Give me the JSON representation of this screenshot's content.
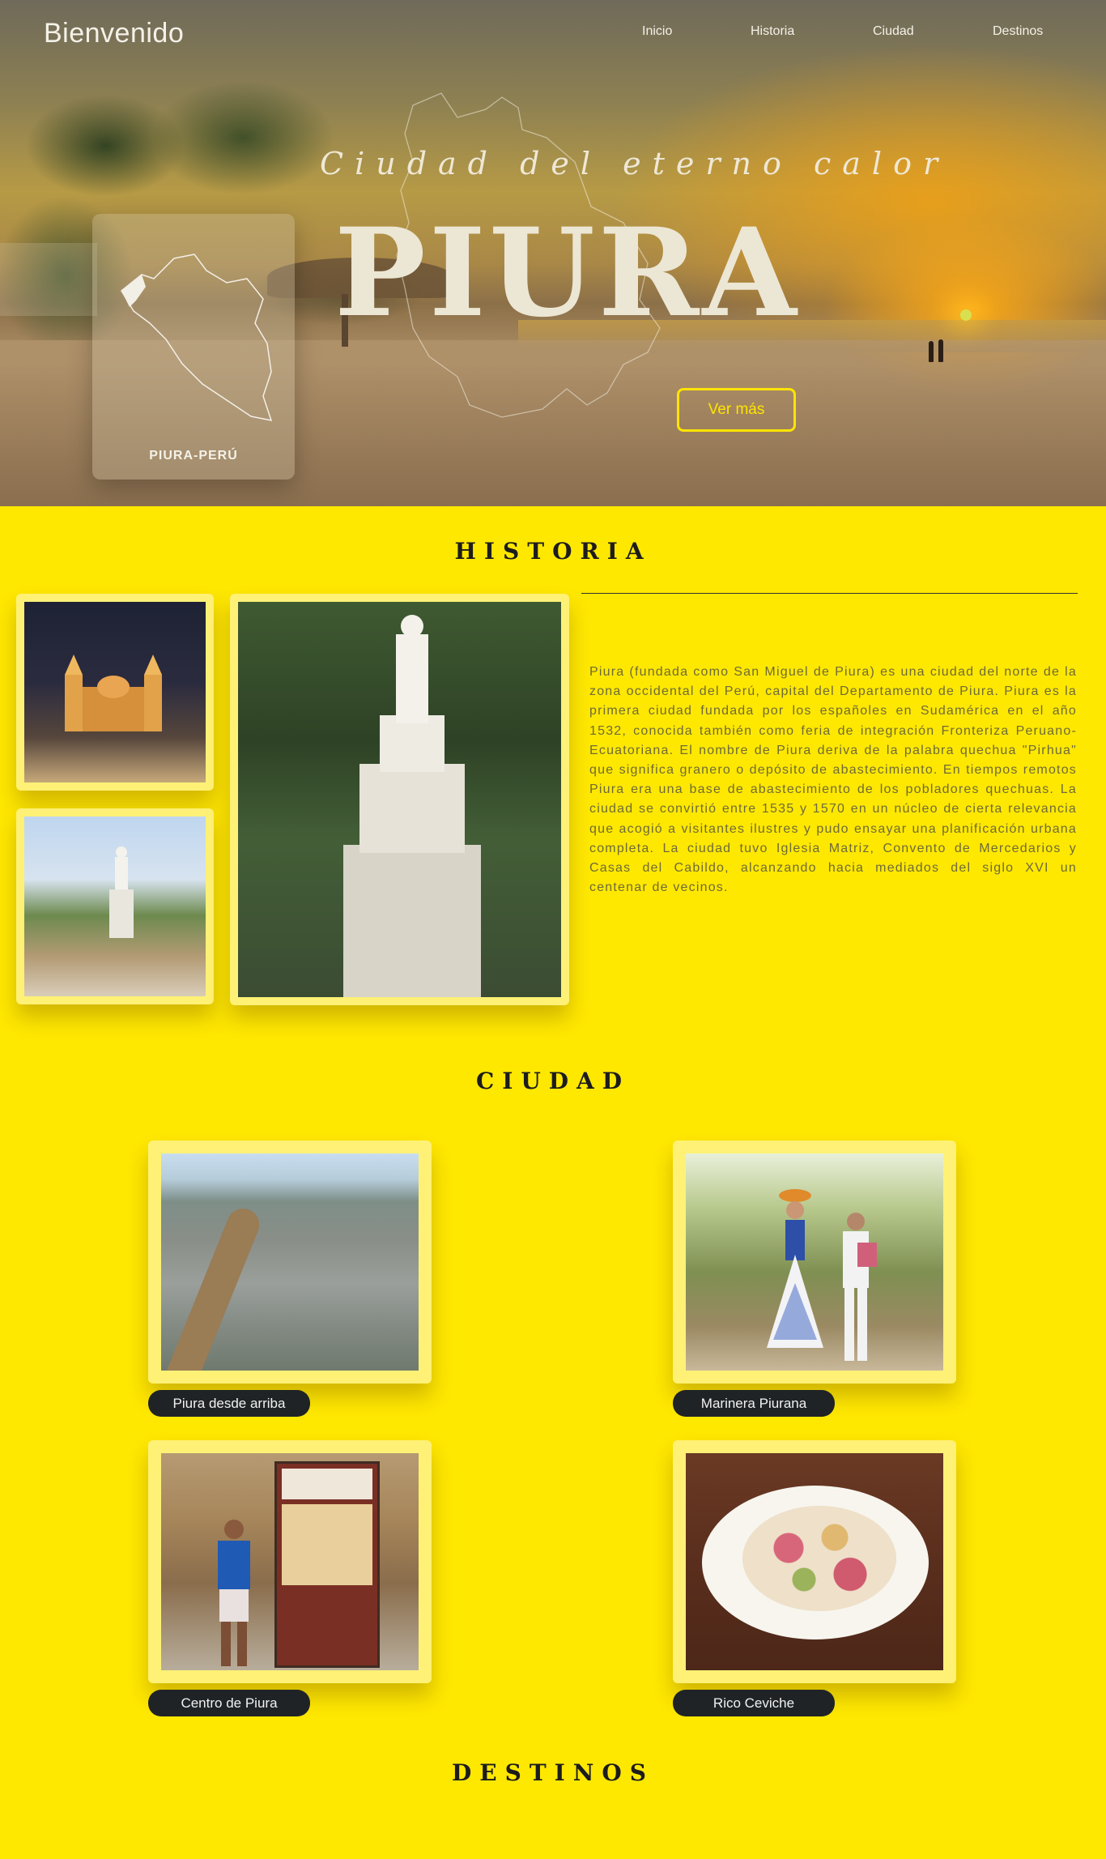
{
  "header": {
    "brand": "Bienvenido",
    "nav": {
      "inicio": "Inicio",
      "historia": "Historia",
      "ciudad": "Ciudad",
      "destinos": "Destinos"
    }
  },
  "hero": {
    "tagline": "Ciudad del eterno calor",
    "title": "PIURA",
    "cta_label": "Ver más",
    "card_label": "PIURA-PERÚ"
  },
  "historia": {
    "title": "HISTORIA",
    "text": "Piura (fundada como San Miguel de Piura) es una ciudad del norte de la zona occidental del Perú, capital del Departamento de Piura. Piura es la primera ciudad fundada por los españoles en Sudamérica en el año 1532, conocida también como feria de integración Fronteriza Peruano-Ecuatoriana. El nombre de Piura deriva de la palabra quechua \"Pirhua\" que significa granero o depósito de abastecimiento. En tiempos remotos Piura era una base de abastecimiento de los pobladores quechuas. La ciudad se convirtió entre 1535 y 1570 en un núcleo de cierta relevancia que acogió a visitantes ilustres y pudo ensayar una planificación urbana completa. La ciudad tuvo Iglesia Matriz, Convento de Mercedarios y Casas del Cabildo, alcanzando hacia mediados del siglo XVI un centenar de vecinos."
  },
  "ciudad": {
    "title": "CIUDAD",
    "cards": [
      {
        "label": "Piura desde arriba"
      },
      {
        "label": "Marinera Piurana"
      },
      {
        "label": "Centro de Piura"
      },
      {
        "label": "Rico Ceviche"
      }
    ]
  },
  "destinos": {
    "title": "DESTINOS"
  },
  "colors": {
    "page_background": "#ffe800",
    "cta_border": "#ffe400",
    "pill_background": "#1f2326"
  }
}
